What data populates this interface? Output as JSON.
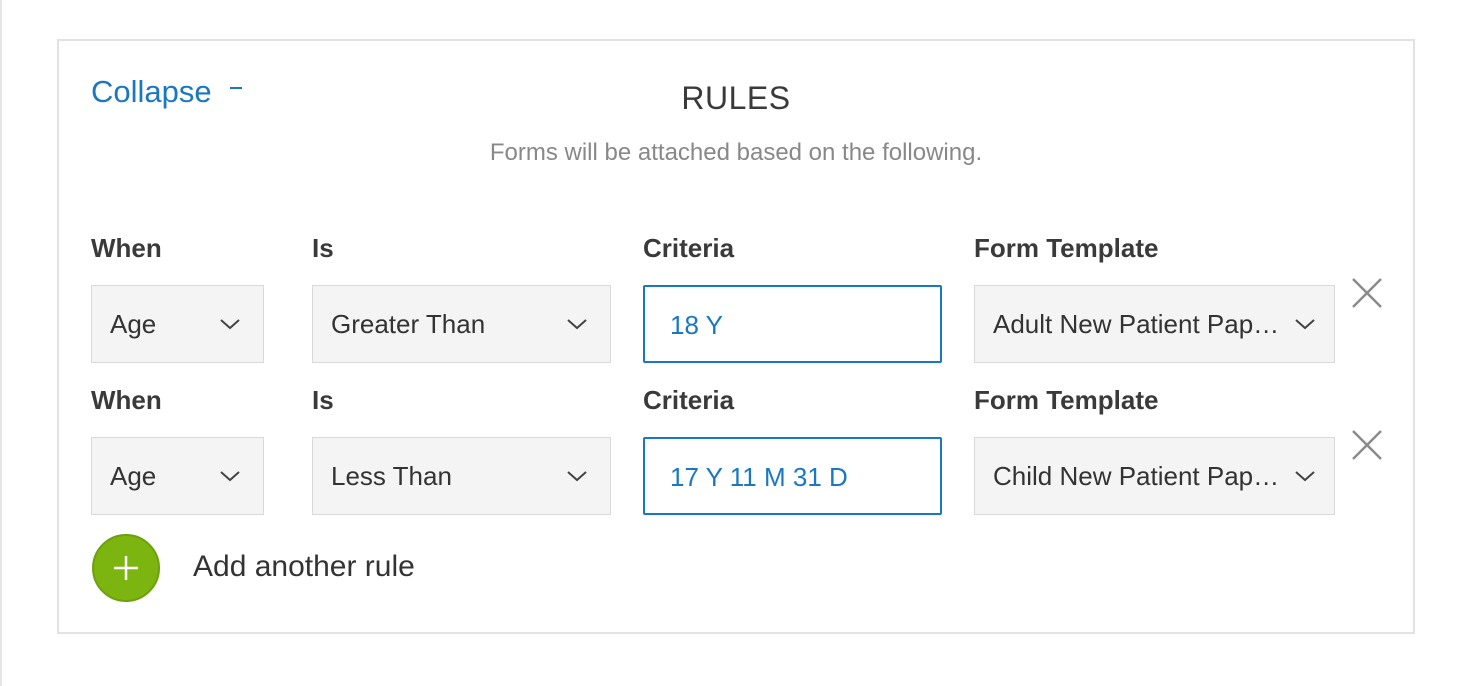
{
  "collapse_label": "Collapse",
  "title": "RULES",
  "subtitle": "Forms will be attached based on the following.",
  "colors": {
    "accent_blue": "#1a78c2",
    "add_green": "#7db510",
    "field_bg": "#f4f4f4"
  },
  "rules": [
    {
      "when_label": "When",
      "is_label": "Is",
      "criteria_label": "Criteria",
      "template_label": "Form Template",
      "when_value": "Age",
      "is_value": "Greater Than",
      "criteria_value": "18 Y",
      "template_value": "Adult New Patient Pap…"
    },
    {
      "when_label": "When",
      "is_label": "Is",
      "criteria_label": "Criteria",
      "template_label": "Form Template",
      "when_value": "Age",
      "is_value": "Less Than",
      "criteria_value": "17 Y 11 M 31 D",
      "template_value": "Child New Patient Pap…"
    }
  ],
  "add_rule_label": "Add another rule",
  "icons": {
    "dropdown": "chevron-down-icon",
    "remove": "close-icon",
    "add": "plus-icon",
    "collapse": "minus-icon"
  }
}
